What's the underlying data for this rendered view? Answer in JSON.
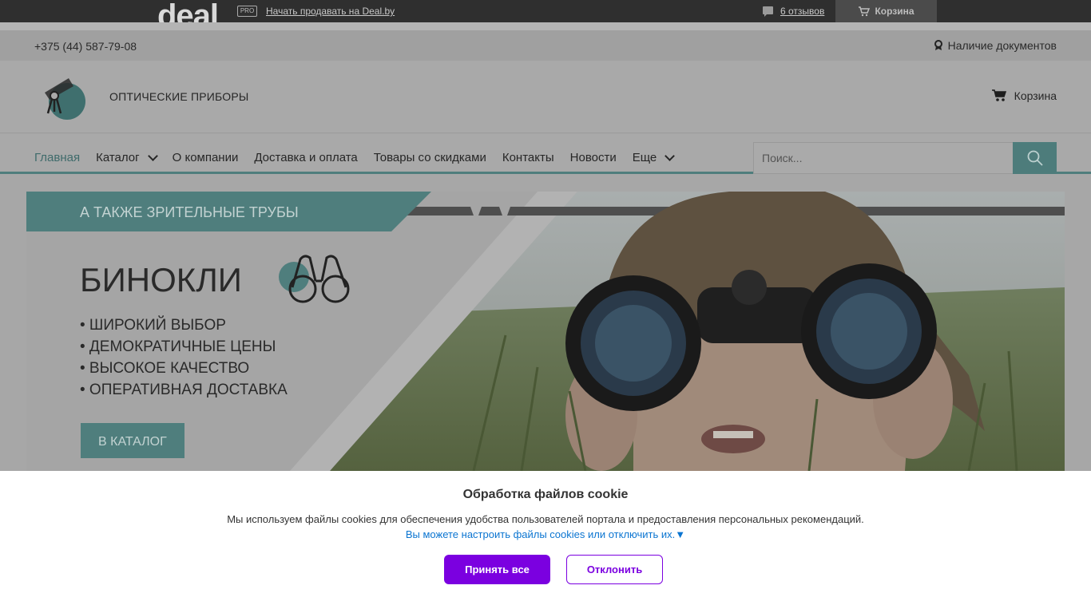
{
  "topbar": {
    "logo_text": "deal",
    "pro_badge": "PRO",
    "sell_link": "Начать продавать на Deal.by",
    "reviews": "6 отзывов",
    "cart": "Корзина"
  },
  "header": {
    "phone": "+375 (44) 587-79-08",
    "documents": "Наличие документов",
    "brand": "ОПТИЧЕСКИЕ ПРИБОРЫ",
    "cart": "Корзина"
  },
  "nav": {
    "items": [
      {
        "label": "Главная"
      },
      {
        "label": "Каталог"
      },
      {
        "label": "О компании"
      },
      {
        "label": "Доставка и оплата"
      },
      {
        "label": "Товары со скидками"
      },
      {
        "label": "Контакты"
      },
      {
        "label": "Новости"
      },
      {
        "label": "Еще"
      }
    ],
    "search_placeholder": "Поиск..."
  },
  "banner": {
    "ribbon": "А ТАКЖЕ ЗРИТЕЛЬНЫЕ ТРУБЫ",
    "title": "БИНОКЛИ",
    "bullets": [
      "• ШИРОКИЙ ВЫБОР",
      "• ДЕМОКРАТИЧНЫЕ ЦЕНЫ",
      "• ВЫСОКОЕ КАЧЕСТВО",
      "• ОПЕРАТИВНАЯ ДОСТАВКА"
    ],
    "button": "В КАТАЛОГ"
  },
  "cookie": {
    "title": "Обработка файлов cookie",
    "text": "Мы используем файлы cookies для обеспечения удобства пользователей портала и предоставления персональных рекомендаций.",
    "configure": "Вы можете настроить файлы cookies или отключить их.▼",
    "accept": "Принять все",
    "decline": "Отклонить"
  },
  "colors": {
    "accent": "#4d7c7b",
    "cookie_button": "#7b00e0",
    "link": "#0b75d1"
  }
}
